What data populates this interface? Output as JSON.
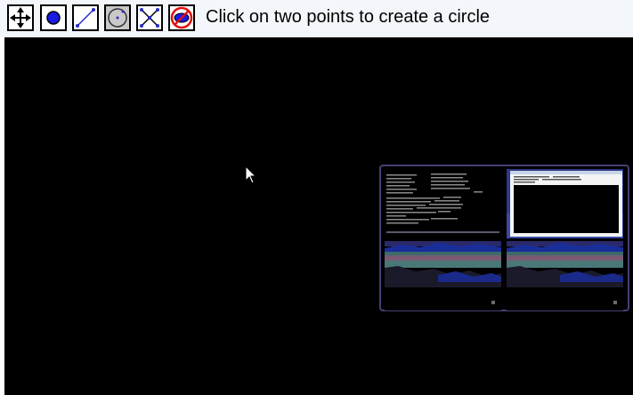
{
  "toolbar": {
    "tools": [
      {
        "icon": "move-icon",
        "selected": false
      },
      {
        "icon": "point-icon",
        "selected": false
      },
      {
        "icon": "line-icon",
        "selected": false
      },
      {
        "icon": "circle-icon",
        "selected": true
      },
      {
        "icon": "intersect-icon",
        "selected": false
      },
      {
        "icon": "hide-icon",
        "selected": false
      }
    ],
    "status_text": "Click on two points to create a circle"
  },
  "canvas": {
    "background": "#000000",
    "pointer": "arrow-cursor-icon"
  },
  "overview": {
    "border_color": "#4b3d73",
    "workspaces": [
      {
        "content": "terminal-text"
      },
      {
        "content": "application-window"
      },
      {
        "content": "landscape-wallpaper"
      },
      {
        "content": "landscape-wallpaper"
      }
    ]
  }
}
